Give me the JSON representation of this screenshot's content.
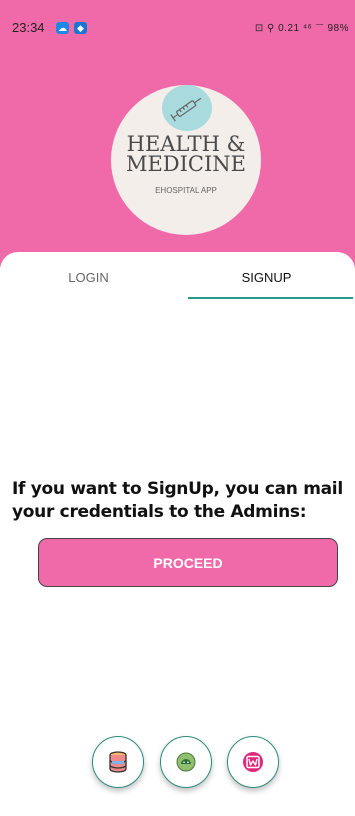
{
  "status_bar": {
    "time": "23:34",
    "right_text": "⊡ ⚲ 0.21 ⁴⁶ 𝍲 98%"
  },
  "logo": {
    "title_line1": "HEALTH &",
    "title_line2": "MEDICINE",
    "subtitle": "EHOSPITAL APP",
    "icon": "syringe-icon"
  },
  "tabs": [
    {
      "label": "LOGIN",
      "active": false
    },
    {
      "label": "SIGNUP",
      "active": true
    }
  ],
  "signup": {
    "message": "If you want to SignUp, you can mail your credentials to the Admins:",
    "proceed_label": "PROCEED"
  },
  "fab_buttons": [
    {
      "icon": "database-icon"
    },
    {
      "icon": "android-icon"
    },
    {
      "icon": "wamp-icon"
    }
  ],
  "colors": {
    "header_pink": "#f06aa9",
    "accent_teal": "#26998a",
    "logo_bg": "#f3eeea",
    "logo_blob": "#a9dadd"
  }
}
